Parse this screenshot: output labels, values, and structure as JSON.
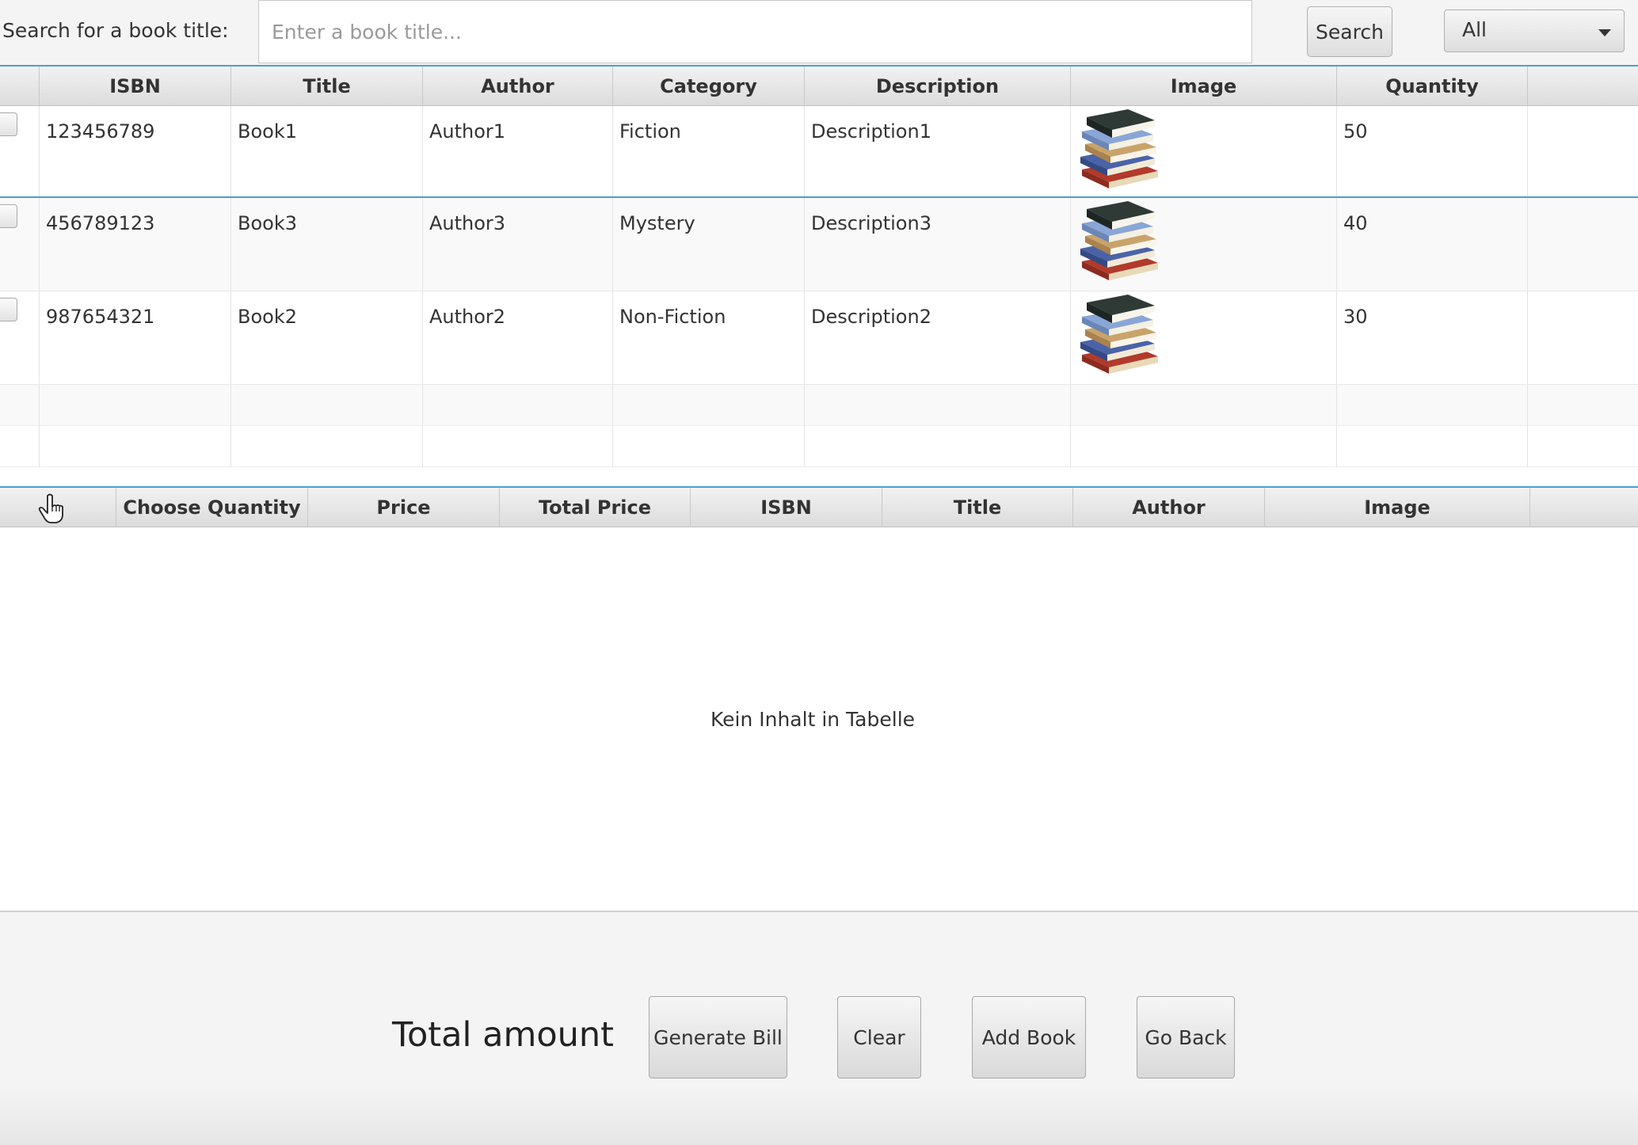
{
  "search": {
    "label": "Search for a book title:",
    "placeholder": "Enter a book title...",
    "value": "",
    "button_label": "Search",
    "category_selected": "All"
  },
  "books_table": {
    "columns": [
      "ISBN",
      "Title",
      "Author",
      "Category",
      "Description",
      "Image",
      "Quantity"
    ],
    "rows": [
      {
        "checked": false,
        "isbn": "123456789",
        "title": "Book1",
        "author": "Author1",
        "category": "Fiction",
        "description": "Description1",
        "image": "book-stack-icon",
        "quantity": "50"
      },
      {
        "checked": false,
        "isbn": "456789123",
        "title": "Book3",
        "author": "Author3",
        "category": "Mystery",
        "description": "Description3",
        "image": "book-stack-icon",
        "quantity": "40"
      },
      {
        "checked": false,
        "isbn": "987654321",
        "title": "Book2",
        "author": "Author2",
        "category": "Non-Fiction",
        "description": "Description2",
        "image": "book-stack-icon",
        "quantity": "30"
      }
    ]
  },
  "cart_table": {
    "columns": [
      "Choose Quantity",
      "Price",
      "Total Price",
      "ISBN",
      "Title",
      "Author",
      "Image"
    ],
    "empty_message": "Kein Inhalt in Tabelle"
  },
  "footer": {
    "total_label": "Total amount",
    "buttons": {
      "generate_bill": "Generate Bill",
      "clear": "Clear",
      "add_book": "Add Book",
      "go_back": "Go Back"
    }
  },
  "colors": {
    "header_accent": "#4a9fd4",
    "background": "#f4f4f4"
  }
}
